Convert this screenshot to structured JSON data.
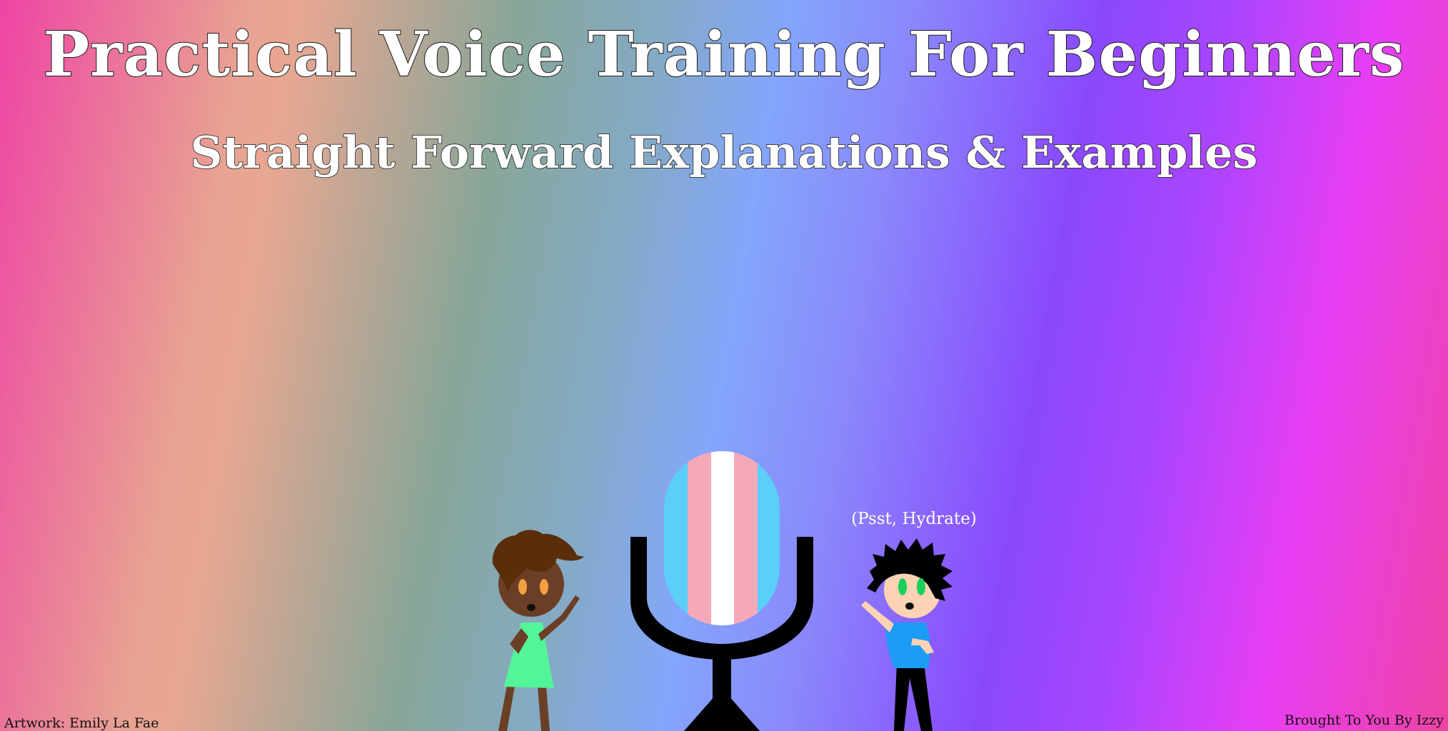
{
  "banner": {
    "title": "Practical Voice Training For Beginners",
    "subtitle": "Straight Forward Explanations & Examples",
    "speech": "(Psst, Hydrate)",
    "artwork_credit": "Artwork: Emily La Fae",
    "author_credit": "Brought To You By Izzy"
  },
  "illustration": {
    "microphone_flag_colors": [
      "#5bcefa",
      "#f5a9b8",
      "#ffffff",
      "#f5a9b8",
      "#5bcefa"
    ],
    "microphone_stand_color": "#000000",
    "left_character": {
      "skin": "#6b3f26",
      "hair": "#5a2e0a",
      "eyes": "#f5a142",
      "dress": "#52f598"
    },
    "right_character": {
      "skin": "#fcd3b5",
      "hair": "#000000",
      "eyes": "#1ad05a",
      "shirt": "#1c9cf5",
      "pants": "#000000"
    }
  }
}
